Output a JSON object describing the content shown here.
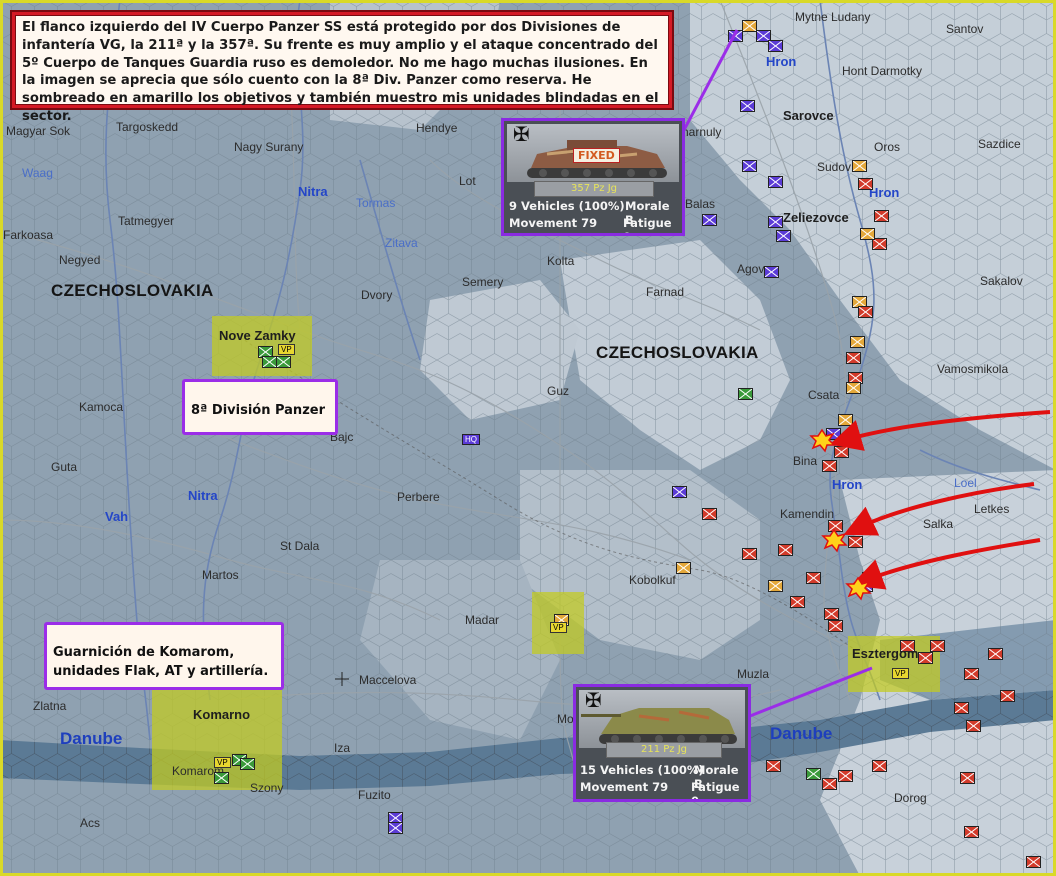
{
  "note": {
    "text": "El flanco izquierdo del IV Cuerpo Panzer SS está protegido por dos Divisiones de infantería VG, la 211ª y la 357ª. Su frente es muy amplio y el ataque concentrado del 5º Cuerpo de Tanques Guardia ruso es demoledor. No me hago muchas ilusiones. En la imagen se aprecia que sólo cuento con la 8ª Div. Panzer como reserva. He sombreado en amarillo los objetivos y también muestro mis unidades blindadas en el sector."
  },
  "countries": [
    "CZECHOSLOVAKIA",
    "CZECHOSLOVAKIA"
  ],
  "rivers": {
    "hron_1": "Hron",
    "hron_2": "Hron",
    "hron_3": "Hron",
    "nitra_1": "Nitra",
    "nitra_2": "Nitra",
    "tormas": "Tormas",
    "zitava": "Zitava",
    "waag": "Waag",
    "vah": "Vah",
    "loel": "Loel",
    "danube_1": "Danube",
    "danube_2": "Danube"
  },
  "towns": {
    "mytne_ludany": "Mytne Ludany",
    "santov": "Santov",
    "hont_darmotky": "Hont Darmotky",
    "sarovce": "Sarovce",
    "ros": "Oros",
    "sazdice": "Sazdice",
    "sudov": "Sudov",
    "zeliezovce": "Zeliezovce",
    "agov": "Agov",
    "sakalov": "Sakalov",
    "vamosmikola": "Vamosmikola",
    "csata": "Csata",
    "bina": "Bina",
    "kamendin": "Kamendin",
    "salka": "Salka",
    "letkes": "Letkes",
    "kobolkuf": "Kobolkuf",
    "muzla": "Muzla",
    "esztergom": "Esztergom",
    "dorog": "Dorog",
    "magyar_sok": "Magyar Sok",
    "targoskedd": "Targoskedd",
    "hendye": "Hendye",
    "nagy_surany": "Nagy Surany",
    "lot": "Lot",
    "tatmegyer": "Tatmegyer",
    "farkoasa": "Farkoasa",
    "negyed": "Negyed",
    "semery": "Semery",
    "kolta": "Kolta",
    "farnad": "Farnad",
    "dvory": "Dvory",
    "nove_zamky": "Nove Zamky",
    "guz": "Guz",
    "kamoca": "Kamoca",
    "bajc": "Bajc",
    "guta": "Guta",
    "perbere": "Perbere",
    "st_dala": "St Dala",
    "martos": "Martos",
    "madar": "Madar",
    "maccelova": "Maccelova",
    "zlatna": "Zlatna",
    "komarno": "Komarno",
    "komarom": "Komarom",
    "iza": "Iza",
    "szony": "Szony",
    "fuzito": "Fuzito",
    "acs": "Acs",
    "mo": "Mo",
    "harnuly": "harnuly",
    "balas": "Balas"
  },
  "callouts": {
    "panzer8": "8ª División Panzer",
    "komarom": "Guarnición de Komarom, unidades Flak, AT y artillería."
  },
  "panel_top": {
    "status_tag": "FIXED",
    "unit_name": "357 Pz Jg",
    "vehicles": "9 Vehicles (100%)",
    "morale": "Morale B",
    "movement": "Movement 79",
    "fatigue": "Fatigue 0"
  },
  "panel_bottom": {
    "unit_name": "211 Pz Jg",
    "vehicles": "15 Vehicles (100%)",
    "morale": "Morale B",
    "movement": "Movement 79",
    "fatigue": "Fatigue 0"
  },
  "markers": {
    "vp": "VP",
    "hq": "HQ"
  },
  "colors": {
    "sea_hex": "#8aa0b4",
    "land_light": "#c9d3dc",
    "objective": "#c4cc1e",
    "german_unit": "#5b3bd6",
    "soviet_unit": "#d23a2a",
    "callout_border": "#9b2de8",
    "note_border": "#d51a26",
    "attack_arrow": "#e01010",
    "frame": "#d9d928"
  }
}
